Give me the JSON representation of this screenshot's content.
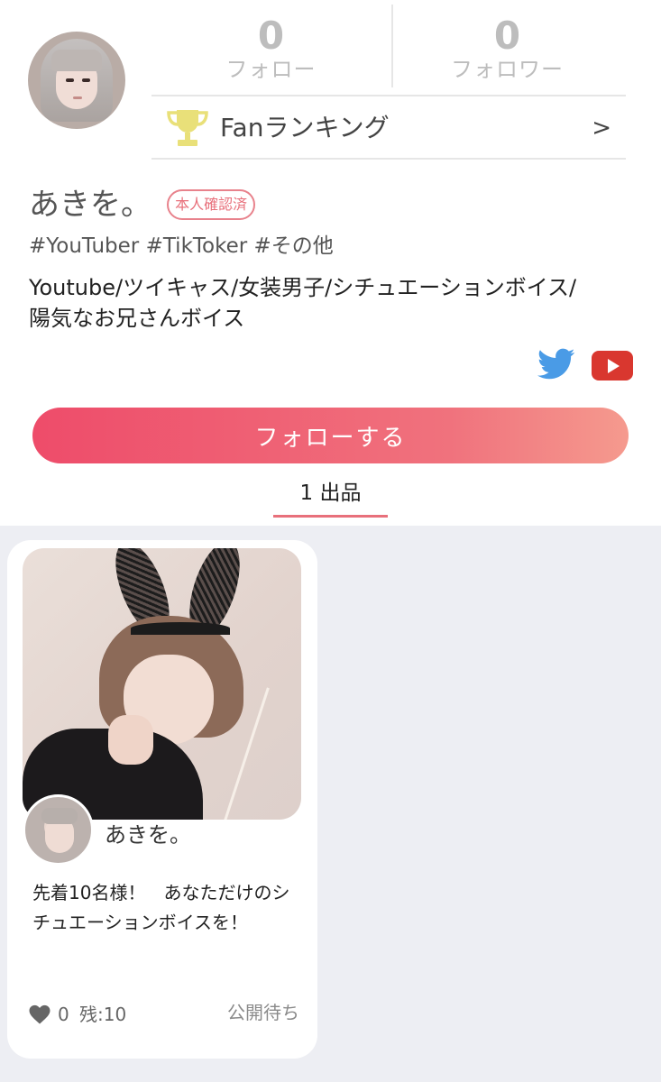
{
  "profile": {
    "follow_count": "0",
    "follow_label": "フォロー",
    "follower_count": "0",
    "follower_label": "フォロワー",
    "ranking_label": "Fanランキング",
    "ranking_arrow": ">",
    "name": "あきを。",
    "verified_badge": "本人確認済",
    "tags": "#YouTuber #TikToker #その他",
    "bio_line1": "Youtube/ツイキャス/女装男子/シチュエーションボイス/",
    "bio_line2": "陽気なお兄さんボイス",
    "social_icons": [
      "twitter-icon",
      "youtube-icon"
    ],
    "follow_button_label": "フォローする"
  },
  "tabs": {
    "products_label": "1 出品"
  },
  "products": [
    {
      "creator_name": "あきを。",
      "description": "先着10名様！　あなただけのシチュエーションボイスを！",
      "like_count": "0",
      "remaining": "残:10",
      "status": "公開待ち"
    }
  ],
  "colors": {
    "accent": "#ee4c6a",
    "accent_gradient_end": "#f59a8e",
    "verified": "#e8707b",
    "trophy": "#e9e079",
    "twitter": "#4a9be6",
    "youtube": "#d9372f",
    "grid_background": "#edeef3"
  }
}
